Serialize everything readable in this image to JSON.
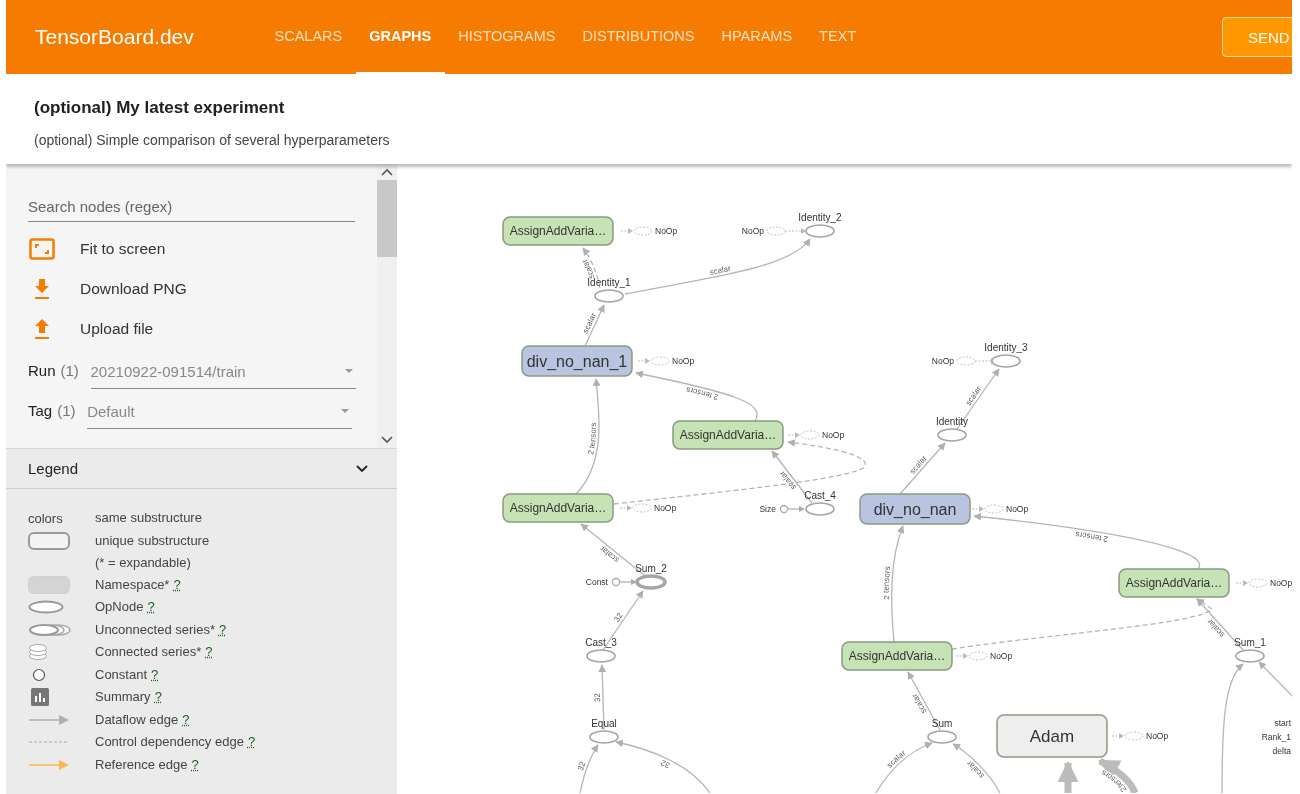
{
  "app_bar": {
    "title": "TensorBoard.dev",
    "tabs": [
      {
        "label": "SCALARS",
        "selected": false
      },
      {
        "label": "GRAPHS",
        "selected": true
      },
      {
        "label": "HISTOGRAMS",
        "selected": false
      },
      {
        "label": "DISTRIBUTIONS",
        "selected": false
      },
      {
        "label": "HPARAMS",
        "selected": false
      },
      {
        "label": "TEXT",
        "selected": false
      }
    ],
    "button": "SEND"
  },
  "experiment": {
    "title": "(optional) My latest experiment",
    "description": "(optional) Simple comparison of several hyperparameters"
  },
  "sidebar": {
    "search": {
      "placeholder": "Search nodes (regex)"
    },
    "actions": [
      {
        "kind": "fit",
        "label": "Fit to screen"
      },
      {
        "kind": "download",
        "label": "Download PNG"
      },
      {
        "kind": "upload",
        "label": "Upload file"
      }
    ],
    "selects": [
      {
        "label": "Run",
        "count": "(1)",
        "value": "20210922-091514/train"
      },
      {
        "label": "Tag",
        "count": "(1)",
        "value": "Default"
      }
    ]
  },
  "legend": {
    "title": "Legend",
    "items": [
      {
        "kind": "colors",
        "key_text": "colors",
        "label": "same substructure"
      },
      {
        "kind": "unique",
        "label": "unique substructure",
        "note": "(* = expandable)"
      },
      {
        "kind": "namespace",
        "label": "Namespace*",
        "help": "?"
      },
      {
        "kind": "opnode",
        "label": "OpNode",
        "help": "?"
      },
      {
        "kind": "unconnected",
        "label": "Unconnected series*",
        "help": "?"
      },
      {
        "kind": "connected",
        "label": "Connected series*",
        "help": "?"
      },
      {
        "kind": "constant",
        "label": "Constant",
        "help": "?"
      },
      {
        "kind": "summary",
        "label": "Summary",
        "help": "?"
      },
      {
        "kind": "dataflow",
        "label": "Dataflow edge",
        "help": "?"
      },
      {
        "kind": "control",
        "label": "Control dependency edge",
        "help": "?"
      },
      {
        "kind": "reference",
        "label": "Reference edge",
        "help": "?"
      }
    ]
  },
  "graph": {
    "nodes": [
      {
        "kind": "metanode",
        "label": "AssignAddVaria…",
        "color": "#c6e3b5"
      },
      {
        "kind": "noop",
        "label": "NoOp"
      },
      {
        "kind": "noop",
        "label": "NoOp"
      },
      {
        "kind": "op",
        "label": "Identity_2"
      },
      {
        "kind": "op",
        "label": "Identity_1"
      },
      {
        "kind": "metanode",
        "label": "div_no_nan_1",
        "color": "#b9c5e0"
      },
      {
        "kind": "noop",
        "label": "NoOp"
      },
      {
        "kind": "noop",
        "label": "NoOp"
      },
      {
        "kind": "op",
        "label": "Identity_3"
      },
      {
        "kind": "op",
        "label": "Identity"
      },
      {
        "kind": "metanode",
        "label": "AssignAddVaria…",
        "color": "#c6e3b5"
      },
      {
        "kind": "noop",
        "label": "NoOp"
      },
      {
        "kind": "metanode",
        "label": "AssignAddVaria…",
        "color": "#c6e3b5"
      },
      {
        "kind": "noop",
        "label": "NoOp"
      },
      {
        "kind": "const",
        "label": "Size"
      },
      {
        "kind": "op",
        "label": "Cast_4"
      },
      {
        "kind": "metanode",
        "label": "div_no_nan",
        "color": "#b9c5e0"
      },
      {
        "kind": "noop",
        "label": "NoOp"
      },
      {
        "kind": "op",
        "label": "Sum_2"
      },
      {
        "kind": "const",
        "label": "Const"
      },
      {
        "kind": "metanode",
        "label": "AssignAddVaria…",
        "color": "#c6e3b5"
      },
      {
        "kind": "noop",
        "label": "NoOp"
      },
      {
        "kind": "op",
        "label": "Cast_3"
      },
      {
        "kind": "metanode",
        "label": "AssignAddVaria…",
        "color": "#c6e3b5"
      },
      {
        "kind": "noop",
        "label": "NoOp"
      },
      {
        "kind": "op",
        "label": "Sum_1"
      },
      {
        "kind": "op",
        "label": "Equal"
      },
      {
        "kind": "op",
        "label": "Sum"
      },
      {
        "kind": "metanode",
        "label": "Adam",
        "color": "#eeeeee"
      },
      {
        "kind": "noop",
        "label": "NoOp"
      },
      {
        "kind": "text",
        "label": "start"
      },
      {
        "kind": "text",
        "label": "Rank_1"
      },
      {
        "kind": "text",
        "label": "delta"
      }
    ],
    "edges": [
      {
        "kind": "control",
        "label": "scalar"
      },
      {
        "kind": "dataflow",
        "label": "scalar"
      },
      {
        "kind": "dataflow",
        "label": "scalar"
      },
      {
        "kind": "dataflow",
        "label": "2 tensors"
      },
      {
        "kind": "dataflow",
        "label": "2 tensors"
      },
      {
        "kind": "dataflow",
        "label": "scalar"
      },
      {
        "kind": "control"
      },
      {
        "kind": "dataflow",
        "label": "scalar"
      },
      {
        "kind": "dataflow",
        "label": "32"
      },
      {
        "kind": "dataflow",
        "label": "32"
      },
      {
        "kind": "dataflow",
        "label": "scalar"
      },
      {
        "kind": "dataflow",
        "label": "scalar"
      },
      {
        "kind": "dataflow",
        "label": "2 tensors"
      },
      {
        "kind": "dataflow",
        "label": "2 tensors"
      },
      {
        "kind": "control"
      },
      {
        "kind": "dataflow",
        "label": "scalar"
      },
      {
        "kind": "dataflow",
        "label": "scalar"
      },
      {
        "kind": "dataflow",
        "label": "32"
      },
      {
        "kind": "dataflow",
        "label": "32"
      },
      {
        "kind": "dataflow",
        "label": "scalar"
      },
      {
        "kind": "dataflow",
        "label": "scalar"
      },
      {
        "kind": "thick"
      },
      {
        "kind": "thick",
        "label": "2 tensors"
      },
      {
        "kind": "dataflow"
      },
      {
        "kind": "dataflow"
      }
    ]
  }
}
